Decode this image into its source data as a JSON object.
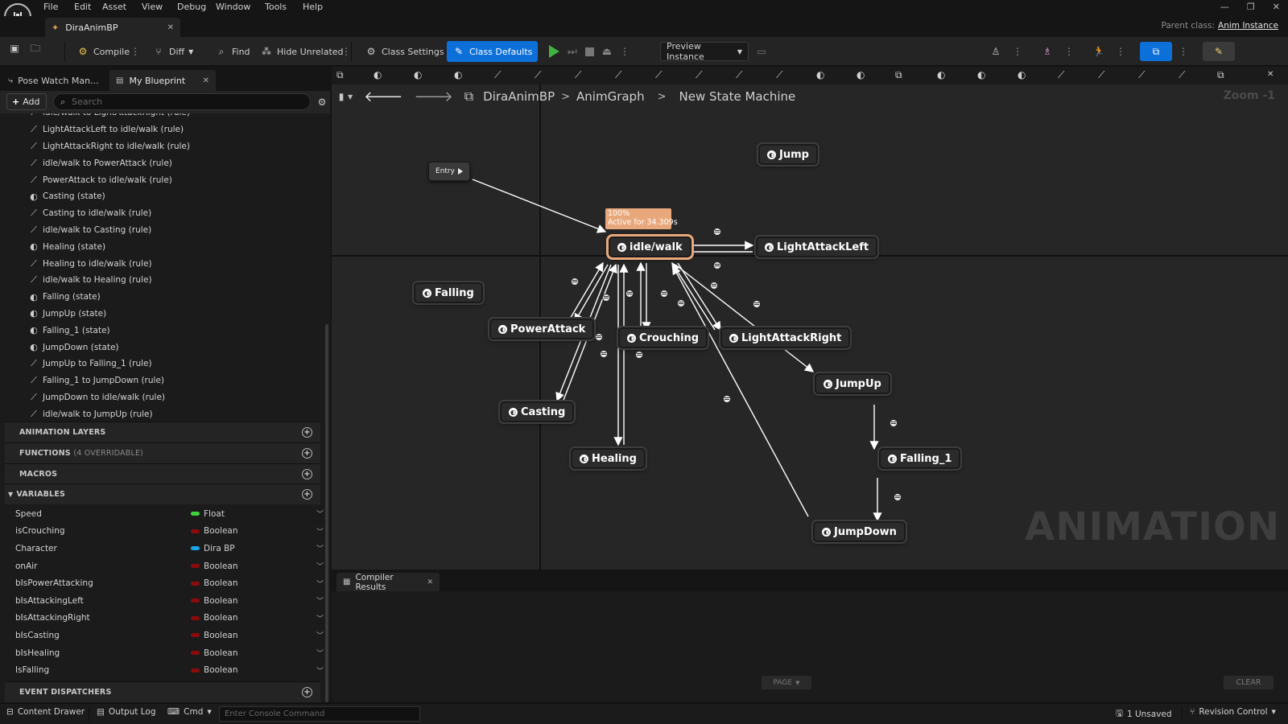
{
  "menu": [
    "File",
    "Edit",
    "Asset",
    "View",
    "Debug",
    "Window",
    "Tools",
    "Help"
  ],
  "tab": {
    "title": "DiraAnimBP"
  },
  "parent_class": {
    "label": "Parent class:",
    "value": "Anim Instance"
  },
  "toolbar": {
    "compile": "Compile",
    "diff": "Diff",
    "find": "Find",
    "hide_unrelated": "Hide Unrelated",
    "class_settings": "Class Settings",
    "class_defaults": "Class Defaults",
    "preview_instance": "Preview Instance"
  },
  "left_tabs": {
    "pose_watch": "Pose Watch Man...",
    "my_blueprint": "My Blueprint"
  },
  "left_toolbar": {
    "add": "Add",
    "search_placeholder": "Search"
  },
  "tree_items": [
    {
      "icon": "transition-rule-icon",
      "label": "idle/walk to LightAttackRight (rule)"
    },
    {
      "icon": "transition-rule-icon",
      "label": "LightAttackLeft to idle/walk (rule)"
    },
    {
      "icon": "transition-rule-icon",
      "label": "LightAttackRight to idle/walk (rule)"
    },
    {
      "icon": "transition-rule-icon",
      "label": "idle/walk to PowerAttack (rule)"
    },
    {
      "icon": "transition-rule-icon",
      "label": "PowerAttack to idle/walk (rule)"
    },
    {
      "icon": "state-icon",
      "label": "Casting (state)"
    },
    {
      "icon": "transition-rule-icon",
      "label": "Casting to idle/walk (rule)"
    },
    {
      "icon": "transition-rule-icon",
      "label": "idle/walk to Casting (rule)"
    },
    {
      "icon": "state-icon",
      "label": "Healing (state)"
    },
    {
      "icon": "transition-rule-icon",
      "label": "Healing to idle/walk (rule)"
    },
    {
      "icon": "transition-rule-icon",
      "label": "idle/walk to Healing (rule)"
    },
    {
      "icon": "state-icon",
      "label": "Falling (state)"
    },
    {
      "icon": "state-icon",
      "label": "JumpUp (state)"
    },
    {
      "icon": "state-icon",
      "label": "Falling_1 (state)"
    },
    {
      "icon": "state-icon",
      "label": "JumpDown (state)"
    },
    {
      "icon": "transition-rule-icon",
      "label": "JumpUp to Falling_1 (rule)"
    },
    {
      "icon": "transition-rule-icon",
      "label": "Falling_1 to JumpDown (rule)"
    },
    {
      "icon": "transition-rule-icon",
      "label": "JumpDown to idle/walk (rule)"
    },
    {
      "icon": "transition-rule-icon",
      "label": "idle/walk to JumpUp (rule)"
    }
  ],
  "sections": {
    "animation_layers": "ANIMATION LAYERS",
    "functions": "FUNCTIONS",
    "functions_note": "(4 OVERRIDABLE)",
    "macros": "MACROS",
    "variables": "VARIABLES",
    "event_dispatchers": "EVENT DISPATCHERS"
  },
  "variables": [
    {
      "name": "Speed",
      "type": "Float",
      "color": "#3fd23f"
    },
    {
      "name": "isCrouching",
      "type": "Boolean",
      "color": "#8b0b0b"
    },
    {
      "name": "Character",
      "type": "Dira BP",
      "color": "#1aa3e8"
    },
    {
      "name": "onAir",
      "type": "Boolean",
      "color": "#8b0b0b"
    },
    {
      "name": "bIsPowerAttacking",
      "type": "Boolean",
      "color": "#8b0b0b"
    },
    {
      "name": "bIsAttackingLeft",
      "type": "Boolean",
      "color": "#8b0b0b"
    },
    {
      "name": "bIsAttackingRight",
      "type": "Boolean",
      "color": "#8b0b0b"
    },
    {
      "name": "bIsCasting",
      "type": "Boolean",
      "color": "#8b0b0b"
    },
    {
      "name": "bIsHealing",
      "type": "Boolean",
      "color": "#8b0b0b"
    },
    {
      "name": "IsFalling",
      "type": "Boolean",
      "color": "#8b0b0b"
    }
  ],
  "breadcrumb": [
    "DiraAnimBP",
    "AnimGraph",
    "New State Machine"
  ],
  "zoom": "Zoom -1",
  "watermark": "ANIMATION",
  "graph": {
    "entry": "Entry",
    "active_badge": {
      "percent": "100%",
      "text": "Active for 34.309s"
    },
    "states": {
      "jump": "Jump",
      "idle_walk": "idle/walk",
      "light_attack_left": "LightAttackLeft",
      "falling": "Falling",
      "power_attack": "PowerAttack",
      "crouching": "Crouching",
      "light_attack_right": "LightAttackRight",
      "jump_up": "JumpUp",
      "casting": "Casting",
      "healing": "Healing",
      "falling_1": "Falling_1",
      "jump_down": "JumpDown"
    }
  },
  "compiler": {
    "tab": "Compiler Results",
    "page": "PAGE",
    "clear": "CLEAR"
  },
  "status_bar": {
    "content_drawer": "Content Drawer",
    "output_log": "Output Log",
    "cmd": "Cmd",
    "console_placeholder": "Enter Console Command",
    "unsaved": "1 Unsaved",
    "revision_control": "Revision Control"
  },
  "colors": {
    "accent": "#0d6fd8",
    "active_state": "#e8a87c",
    "play": "#3fb23f"
  }
}
